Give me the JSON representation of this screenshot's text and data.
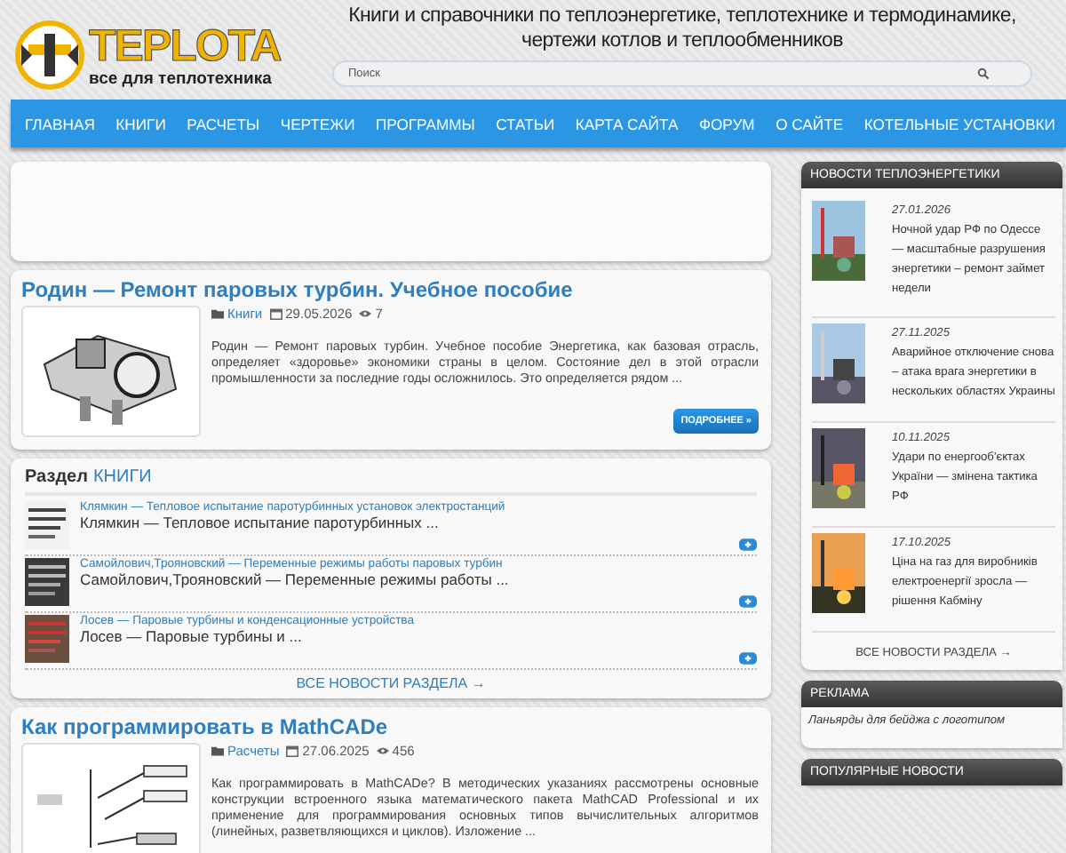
{
  "header": {
    "logo_title": "TEPLOTA",
    "logo_subtitle": "все для теплотехника",
    "tagline": "Книги и справочники по теплоэнергетике, теплотехнике и термодинамике, чертежи котлов и теплообменников",
    "search": {
      "placeholder": "Поиск"
    }
  },
  "nav": [
    "ГЛАВНАЯ",
    "КНИГИ",
    "РАСЧЕТЫ",
    "ЧЕРТЕЖИ",
    "ПРОГРАММЫ",
    "СТАТЬИ",
    "КАРТА САЙТА",
    "ФОРУМ",
    "О САЙТЕ",
    "КОТЕЛЬНЫЕ УСТАНОВКИ"
  ],
  "articles": [
    {
      "title": "Родин — Ремонт паровых турбин. Учебное пособие",
      "category": "Книги",
      "date": "29.05.2026",
      "views": "7",
      "excerpt": "Родин — Ремонт паровых турбин. Учебное пособие Энергетика, как базовая отрасль, определяет «здоровье» экономики страны в целом. Состояние дел в этой отрасли промышленности за последние годы осложнилось. Это определяется рядом ...",
      "more_button": "ПОДРОБНЕЕ »"
    }
  ],
  "section": {
    "label": "Раздел",
    "name": "КНИГИ",
    "items": [
      {
        "link": "Клямкин — Тепловое испытание паротурбинных установок электростанций",
        "title": "Клямкин — Тепловое испытание паротурбинных ..."
      },
      {
        "link": "Самойлович,Трояновский — Переменные режимы работы паровых турбин",
        "title": "Самойлович,Трояновский — Переменные режимы работы ..."
      },
      {
        "link": "Лосев — Паровые турбины и конденсационные устройства",
        "title": "Лосев — Паровые турбины и ..."
      }
    ],
    "all_link": "ВСЕ НОВОСТИ РАЗДЕЛА →"
  },
  "articles_after": [
    {
      "title": "Как программировать в MathCADe",
      "category": "Расчеты",
      "date": "27.06.2025",
      "views": "456",
      "excerpt": "Как программировать в MathCADe? В методических указаниях рассмотрены основные конструкции встроенного языка математического пакета MathCAD Professional и их применение для программирования основных типов вычислительных алгоритмов (линейных, разветвляющихся и циклов). Изложение ..."
    }
  ],
  "sidebar": {
    "news": {
      "title": "НОВОСТИ ТЕПЛОЭНЕРГЕТИКИ",
      "items": [
        {
          "date": "27.01.2026",
          "text": "Ночной удар РФ по Одессе — масштабные разрушения энергетики – ремонт займет недели"
        },
        {
          "date": "27.11.2025",
          "text": "Аварийное отключение снова – атака врага энергетики в нескольких областях Украины"
        },
        {
          "date": "10.11.2025",
          "text": "Удари по енергооб'єктах України — змінена тактика РФ"
        },
        {
          "date": "17.10.2025",
          "text": "Ціна на газ для виробників електроенергії зросла — рішення Кабміну"
        }
      ],
      "all_link": "ВСЕ НОВОСТИ РАЗДЕЛА →"
    },
    "ads": {
      "title": "РЕКЛАМА",
      "link": "Ланьярды для бейджа с логотипом"
    },
    "popular": {
      "title": "ПОПУЛЯРНЫЕ НОВОСТИ"
    }
  }
}
